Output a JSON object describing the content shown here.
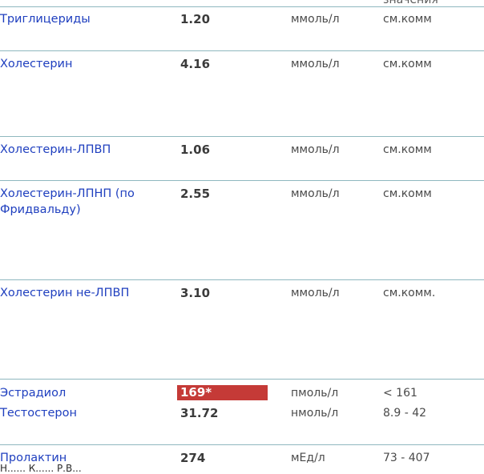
{
  "header": {
    "reference_col_label": "значения"
  },
  "rows": [
    {
      "name": "Триглицериды",
      "value": "1.20",
      "unit": "ммоль/л",
      "reference": "см.комм"
    },
    {
      "name": "Холестерин",
      "value": "4.16",
      "unit": "ммоль/л",
      "reference": "см.комм"
    },
    {
      "name": "Холестерин-ЛПВП",
      "value": "1.06",
      "unit": "ммоль/л",
      "reference": "см.комм"
    },
    {
      "name": "Холестерин-ЛПНП (по Фридвальду)",
      "value": "2.55",
      "unit": "ммоль/л",
      "reference": "см.комм"
    },
    {
      "name": "Холестерин не-ЛПВП",
      "value": "3.10",
      "unit": "ммоль/л",
      "reference": "см.комм."
    },
    {
      "name": "Эстрадиол",
      "value": "169*",
      "unit": "пмоль/л",
      "reference": "< 161",
      "abnormal": true,
      "flag_color": "#c53a37"
    },
    {
      "name": "Тестостерон",
      "value": "31.72",
      "unit": "нмоль/л",
      "reference": "8.9 - 42"
    },
    {
      "name": "Пролактин",
      "value": "274",
      "unit": "мЕд/л",
      "reference": "73 - 407"
    }
  ],
  "footer": {
    "truncated_text": "Н...... К...... Р.В..."
  },
  "colors": {
    "name_text": "#1f3fbf",
    "separator": "#8fb8bf",
    "abnormal_bg": "#c53a37"
  }
}
